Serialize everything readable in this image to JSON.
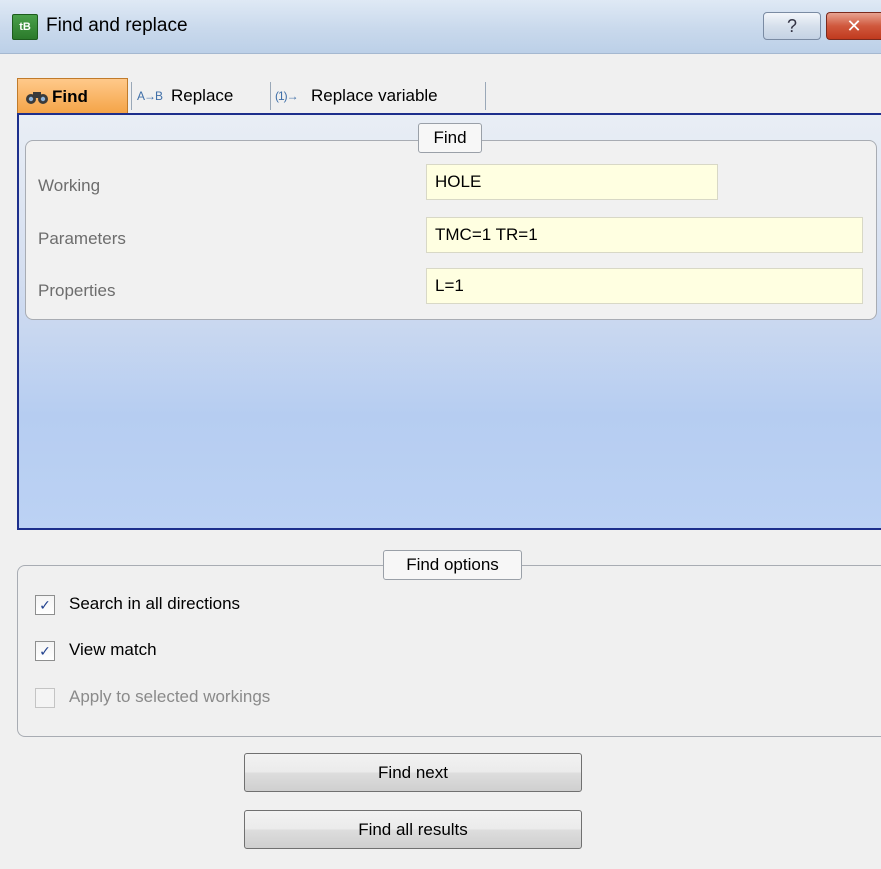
{
  "window": {
    "title": "Find and replace",
    "help_label": "?",
    "close_label": "✕"
  },
  "tabs": [
    {
      "label": "Find",
      "icon": "binoculars-icon",
      "active": true
    },
    {
      "label": "Replace",
      "icon": "replace-icon",
      "icon_text": "A→B",
      "active": false
    },
    {
      "label": "Replace variable",
      "icon": "replace-variable-icon",
      "icon_text": "(1)→",
      "active": false
    }
  ],
  "find_group": {
    "legend": "Find",
    "fields": [
      {
        "label": "Working",
        "value": "HOLE"
      },
      {
        "label": "Parameters",
        "value": "TMC=1 TR=1"
      },
      {
        "label": "Properties",
        "value": "L=1"
      }
    ]
  },
  "options_group": {
    "legend": "Find options",
    "options": [
      {
        "label": "Search in all directions",
        "checked": true,
        "enabled": true
      },
      {
        "label": "View match",
        "checked": true,
        "enabled": true
      },
      {
        "label": "Apply to selected workings",
        "checked": false,
        "enabled": false
      }
    ]
  },
  "buttons": {
    "find_next": "Find next",
    "find_all": "Find all results"
  },
  "colors": {
    "active_tab": "#f4a346",
    "panel_border": "#1d2f8c",
    "input_background": "#ffffe1",
    "checkmark": "#21418e"
  }
}
